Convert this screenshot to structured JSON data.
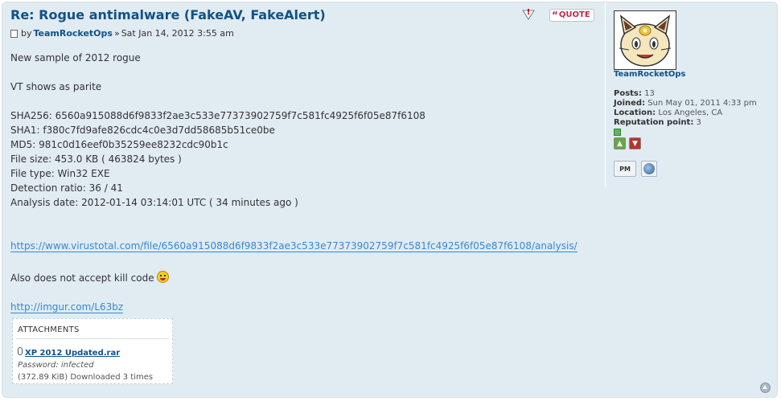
{
  "post": {
    "title_prefix": "Re",
    "title_rest": ": Rogue antimalware (FakeAV, FakeAlert)",
    "by_label": "by",
    "author": "TeamRocketOps",
    "date_sep": " » ",
    "date": "Sat Jan 14, 2012 3:55 am",
    "report_glyph": "!",
    "quote_label": "QUOTE",
    "lines": {
      "l1": "New sample of 2012 rogue",
      "l2": "VT shows as parite",
      "l3": "SHA256: 6560a915088d6f9833f2ae3c533e77373902759f7c581fc4925f6f05e87f6108",
      "l4": "SHA1: f380c7fd9afe826cdc4c0e3d7dd58685b51ce0be",
      "l5": "MD5: 981c0d16eef0b35259ee8232cdc90b1c",
      "l6": "File size: 453.0 KB ( 463824 bytes )",
      "l7": "File type: Win32 EXE",
      "l8": "Detection ratio: 36 / 41",
      "l9": "Analysis date: 2012-01-14 03:14:01 UTC ( 34 minutes ago )",
      "vt_link": "https://www.virustotal.com/file/6560a915088d6f9833f2ae3c533e77373902759f7c581fc4925f6f05e87f6108/analysis/",
      "kill": "Also does not accept kill code ",
      "imgur_link": "http://imgur.com/L63bz"
    },
    "attachments": {
      "header": "ATTACHMENTS",
      "file_name": "XP 2012 Updated.rar",
      "password": "Password: infected",
      "info": "(372.89 KiB) Downloaded 3 times"
    }
  },
  "profile": {
    "name": "TeamRocketOps",
    "posts_label": "Posts:",
    "posts_value": "13",
    "joined_label": "Joined:",
    "joined_value": "Sun May 01, 2011 4:33 pm",
    "location_label": "Location:",
    "location_value": "Los Angeles, CA",
    "rep_label": "Reputation point:",
    "rep_value": "3",
    "pm_label": "PM"
  },
  "icons": {
    "post": "post-icon",
    "report": "report-icon",
    "quote": "quote-icon",
    "smiley": "angry-smiley-icon",
    "clip": "paperclip-icon",
    "thumb_up": "thumbs-up-icon",
    "thumb_down": "thumbs-down-icon",
    "globe": "globe-icon",
    "top": "back-to-top-icon"
  }
}
